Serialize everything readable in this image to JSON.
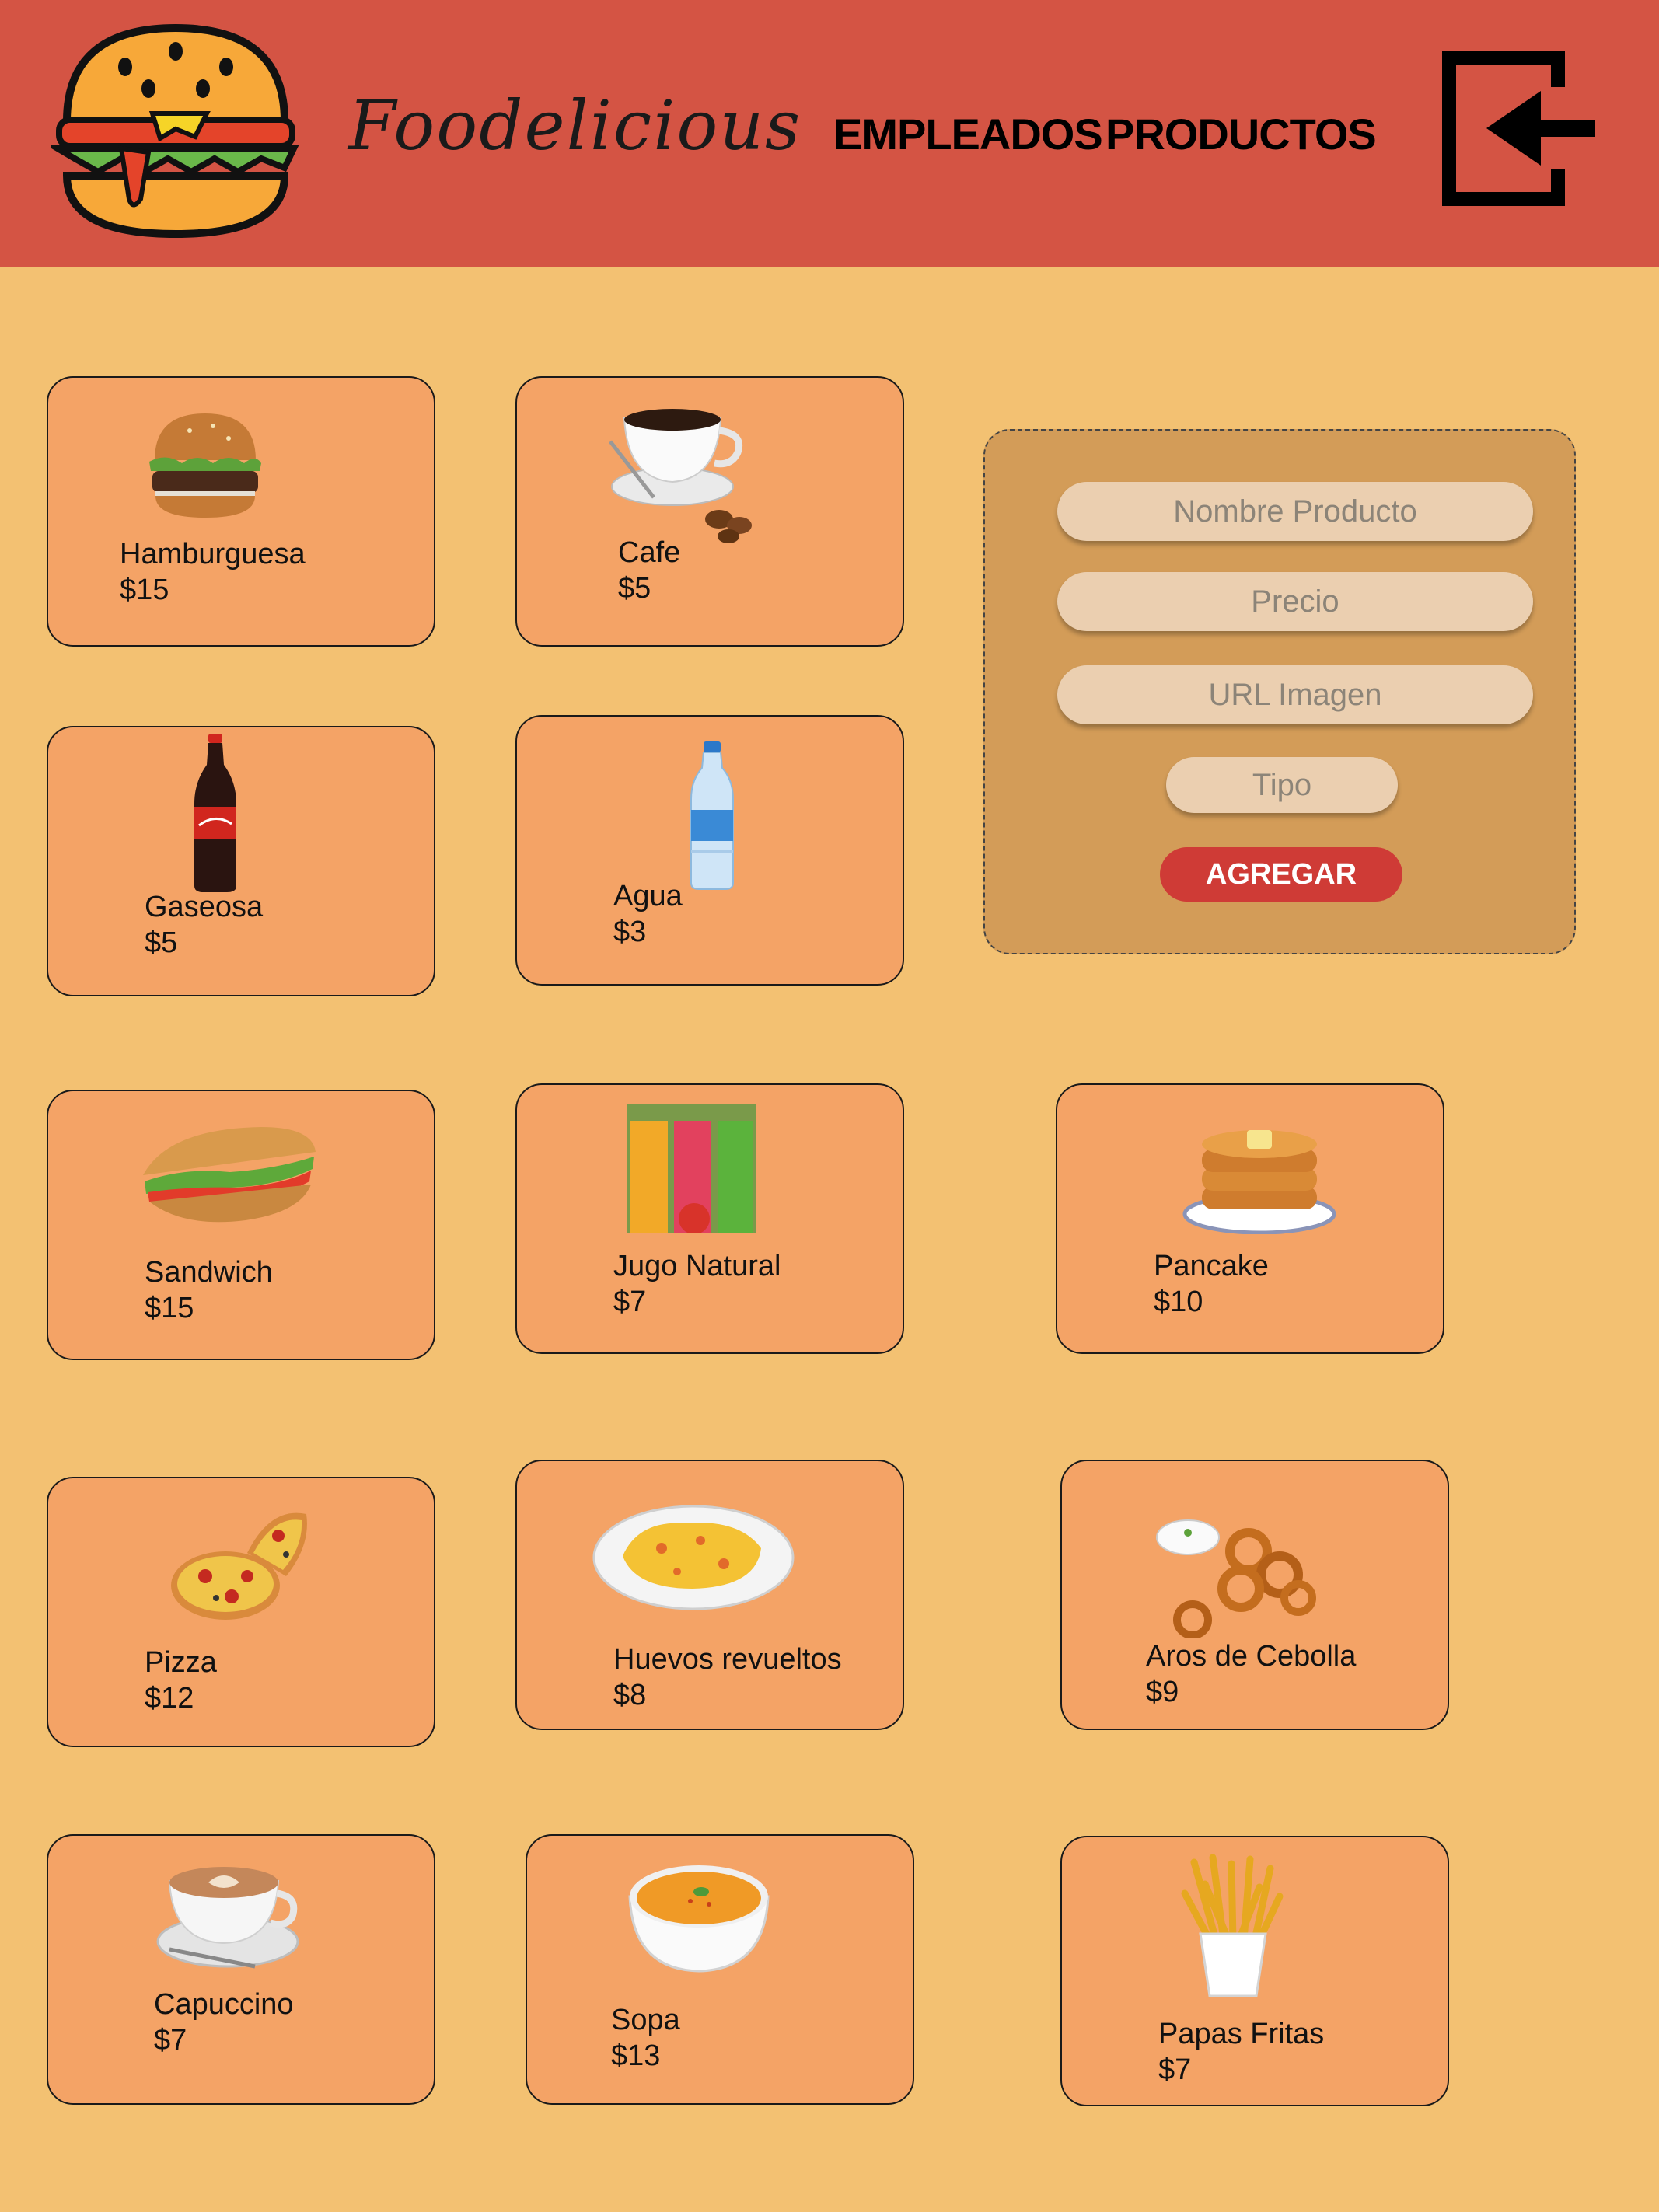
{
  "header": {
    "brand": "Foodelicious",
    "nav_employees": "EMPLEADOS",
    "nav_products": "PRODUCTOS",
    "logo_icon": "burger-logo-icon",
    "logout_icon": "logout-icon"
  },
  "products": [
    {
      "name": "Hamburguesa",
      "price": "$15",
      "icon": "burger-image"
    },
    {
      "name": "Cafe",
      "price": "$5",
      "icon": "coffee-cup-image"
    },
    {
      "name": "Gaseosa",
      "price": "$5",
      "icon": "soda-bottle-image"
    },
    {
      "name": "Agua",
      "price": "$3",
      "icon": "water-bottle-image"
    },
    {
      "name": "Sandwich",
      "price": "$15",
      "icon": "sandwich-image"
    },
    {
      "name": "Jugo Natural",
      "price": "$7",
      "icon": "juice-glasses-image"
    },
    {
      "name": "Pancake",
      "price": "$10",
      "icon": "pancake-image"
    },
    {
      "name": "Pizza",
      "price": "$12",
      "icon": "pizza-image"
    },
    {
      "name": "Huevos revueltos",
      "price": "$8",
      "icon": "scrambled-eggs-image"
    },
    {
      "name": "Aros de Cebolla",
      "price": "$9",
      "icon": "onion-rings-image"
    },
    {
      "name": "Capuccino",
      "price": "$7",
      "icon": "cappuccino-image"
    },
    {
      "name": "Sopa",
      "price": "$13",
      "icon": "soup-bowl-image"
    },
    {
      "name": "Papas Fritas",
      "price": "$7",
      "icon": "french-fries-image"
    }
  ],
  "form": {
    "name_placeholder": "Nombre Producto",
    "price_placeholder": "Precio",
    "url_placeholder": "URL Imagen",
    "type_placeholder": "Tipo",
    "submit_label": "AGREGAR"
  },
  "colors": {
    "header_bg": "#d45444",
    "page_bg": "#f3c172",
    "card_bg": "#f4a366",
    "form_bg": "#d39c58",
    "button_bg": "#cf3b36"
  }
}
